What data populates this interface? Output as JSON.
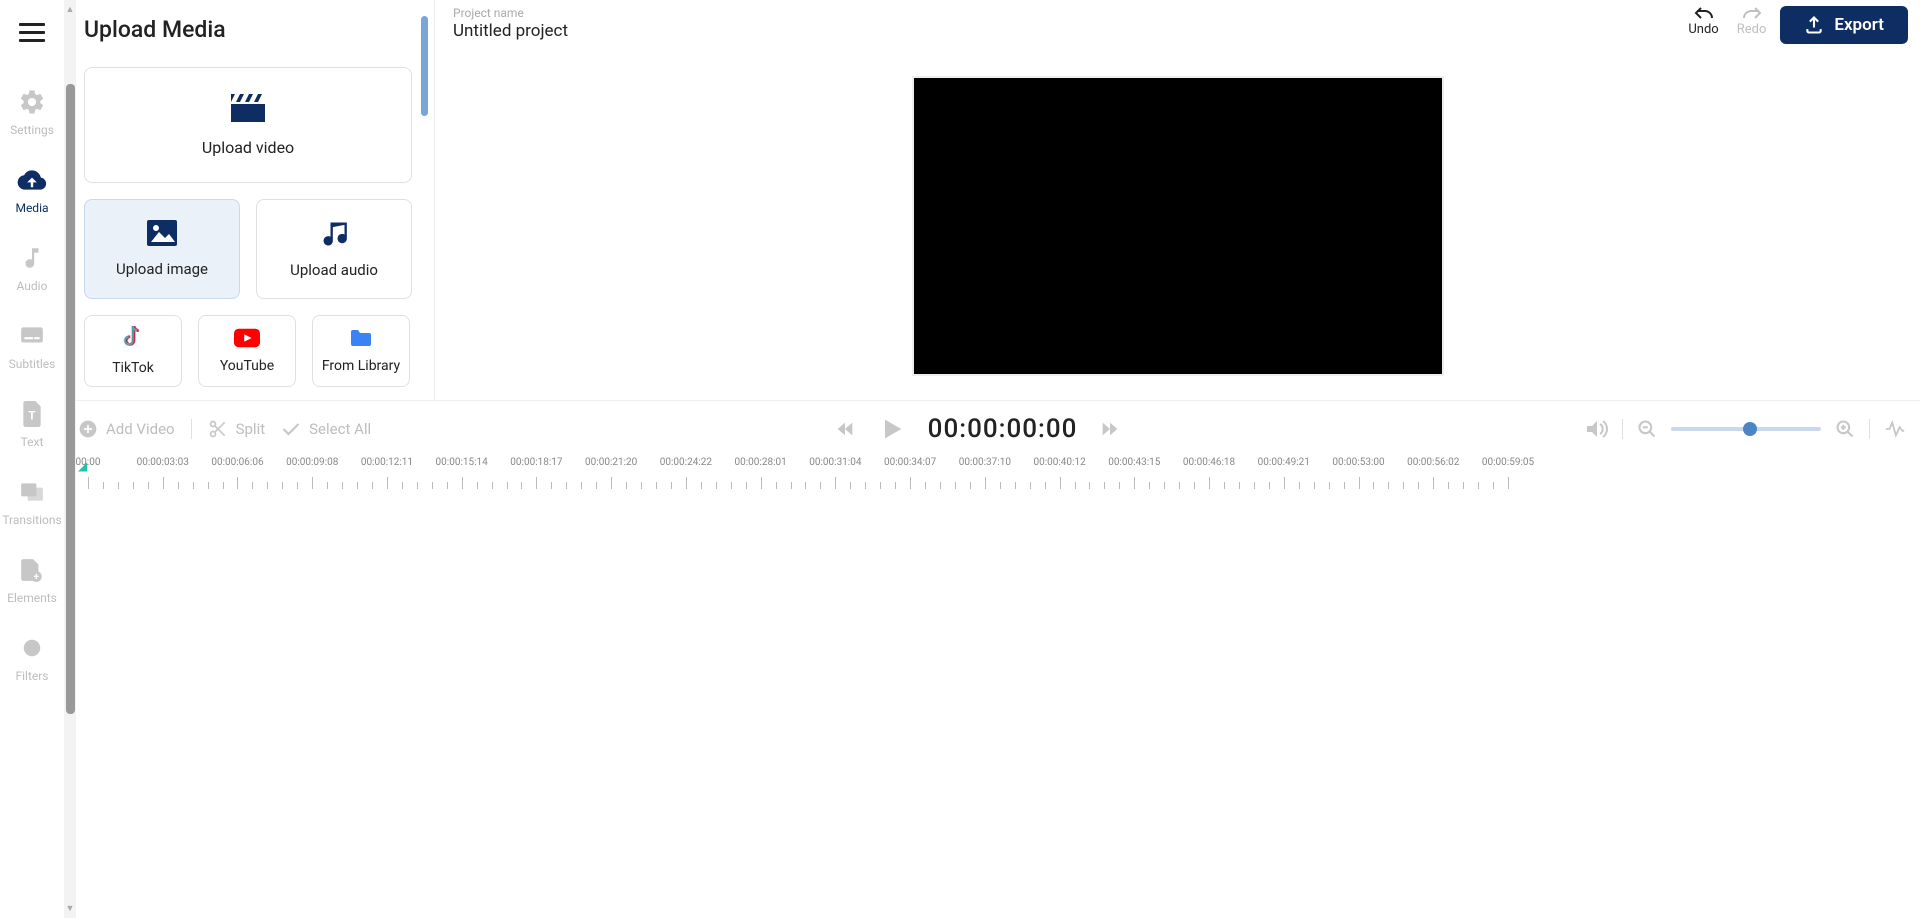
{
  "sidebar": {
    "items": [
      {
        "label": "Settings"
      },
      {
        "label": "Media"
      },
      {
        "label": "Audio"
      },
      {
        "label": "Subtitles"
      },
      {
        "label": "Text"
      },
      {
        "label": "Transitions"
      },
      {
        "label": "Elements"
      },
      {
        "label": "Filters"
      }
    ]
  },
  "mediaPanel": {
    "title": "Upload Media",
    "upload_video": "Upload video",
    "upload_image": "Upload image",
    "upload_audio": "Upload audio",
    "sources": {
      "tiktok": "TikTok",
      "youtube": "YouTube",
      "library": "From Library"
    }
  },
  "topbar": {
    "project_label": "Project name",
    "project_name": "Untitled project",
    "undo": "Undo",
    "redo": "Redo",
    "export": "Export"
  },
  "timeline": {
    "add_video": "Add Video",
    "split": "Split",
    "select_all": "Select All",
    "current_time": "00:00:00:00",
    "ruler": [
      "00:00",
      "00:00:03:03",
      "00:00:06:06",
      "00:00:09:08",
      "00:00:12:11",
      "00:00:15:14",
      "00:00:18:17",
      "00:00:21:20",
      "00:00:24:22",
      "00:00:28:01",
      "00:00:31:04",
      "00:00:34:07",
      "00:00:37:10",
      "00:00:40:12",
      "00:00:43:15",
      "00:00:46:18",
      "00:00:49:21",
      "00:00:53:00",
      "00:00:56:02",
      "00:00:59:05"
    ]
  }
}
